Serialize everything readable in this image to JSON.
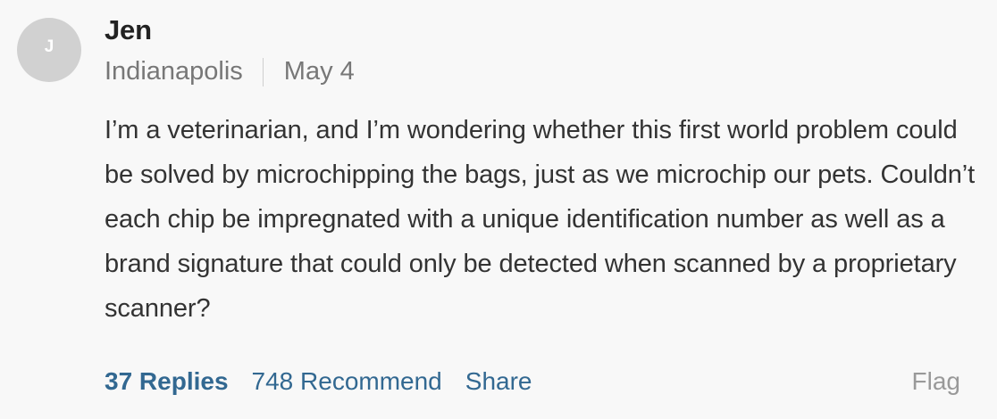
{
  "author": {
    "initial": "J",
    "name": "Jen",
    "location": "Indianapolis",
    "date": "May 4"
  },
  "comment": {
    "text": "I’m a veterinarian, and I’m wondering whether this first world problem could be solved by microchipping the bags, just as we microchip our pets. Couldn’t each chip be impregnated with a unique identification number as well as a brand signature that could only be detected when scanned by a proprietary scanner?"
  },
  "actions": {
    "replies": "37 Replies",
    "recommend": "748 Recommend",
    "share": "Share",
    "flag": "Flag"
  },
  "colors": {
    "action_link": "#326891",
    "flag": "#999999",
    "avatar_bg": "#d1d1d1",
    "background": "#f8f8f8"
  }
}
